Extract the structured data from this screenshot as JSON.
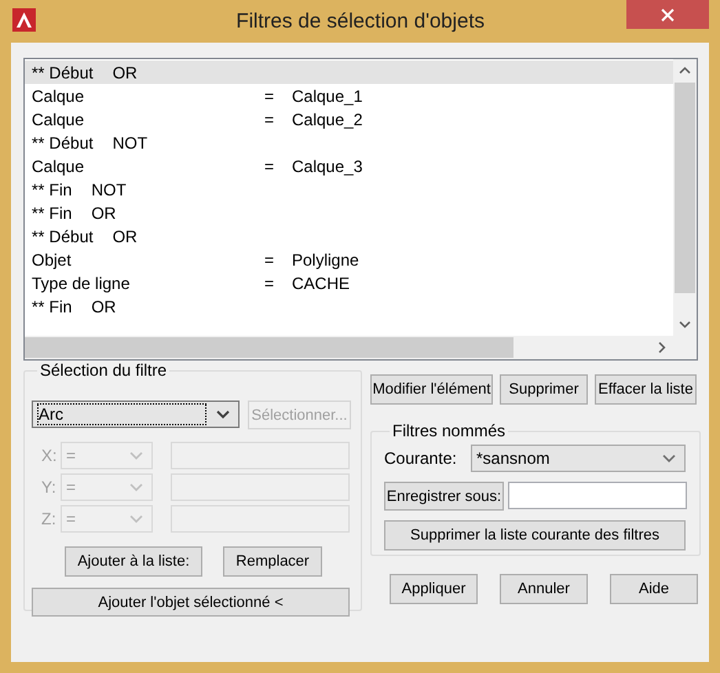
{
  "window": {
    "title": "Filtres de sélection d'objets"
  },
  "filter_list": {
    "rows": [
      {
        "kind": "group",
        "text": "** Début",
        "operator": "OR",
        "selected": true
      },
      {
        "kind": "filter",
        "text": "Calque",
        "operator": "=",
        "value": "Calque_1",
        "selected": false
      },
      {
        "kind": "filter",
        "text": "Calque",
        "operator": "=",
        "value": "Calque_2",
        "selected": false
      },
      {
        "kind": "group",
        "text": "** Début",
        "operator": "NOT",
        "selected": false
      },
      {
        "kind": "filter",
        "text": "Calque",
        "operator": "=",
        "value": "Calque_3",
        "selected": false
      },
      {
        "kind": "group",
        "text": "** Fin",
        "operator": "NOT",
        "selected": false
      },
      {
        "kind": "group",
        "text": "** Fin",
        "operator": "OR",
        "selected": false
      },
      {
        "kind": "group",
        "text": "** Début",
        "operator": "OR",
        "selected": false
      },
      {
        "kind": "filter",
        "text": "Objet",
        "operator": "=",
        "value": "Polyligne",
        "selected": false
      },
      {
        "kind": "filter",
        "text": "Type de ligne",
        "operator": "=",
        "value": "CACHE",
        "selected": false
      },
      {
        "kind": "group",
        "text": "** Fin",
        "operator": "OR",
        "selected": false
      }
    ]
  },
  "filter_selection": {
    "title": "Sélection du filtre",
    "type": "Arc",
    "select_button": {
      "label": "Sélectionner...",
      "disabled": true
    },
    "coordinates": [
      {
        "label": "X:",
        "operator": "=",
        "disabled": true
      },
      {
        "label": "Y:",
        "operator": "=",
        "disabled": true
      },
      {
        "label": "Z:",
        "operator": "=",
        "disabled": true
      }
    ],
    "buttons": [
      "Ajouter à la liste:",
      "Remplacer"
    ],
    "add_selected_button": "Ajouter l'objet sélectionné <"
  },
  "list_buttons": [
    "Modifier l'élément",
    "Supprimer",
    "Effacer la liste"
  ],
  "named_filters": {
    "title": "Filtres nommés",
    "current_label": "Courante:",
    "current": "*sansnom",
    "save_button": "Enregistrer sous:",
    "delete_button": "Supprimer la liste courante des filtres"
  },
  "dialog_buttons": [
    "Appliquer",
    "Annuler",
    "Aide"
  ]
}
